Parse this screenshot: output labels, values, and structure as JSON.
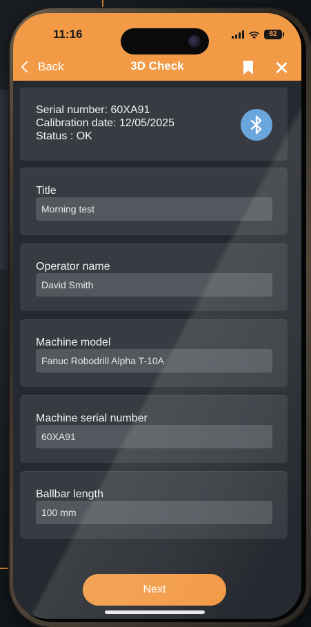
{
  "status_bar": {
    "time": "11:16",
    "battery": "82"
  },
  "nav": {
    "back_label": "Back",
    "title": "3D Check"
  },
  "device": {
    "serial_line": "Serial number: 60XA91",
    "calibration_line": "Calibration date: 12/05/2025",
    "status_line": "Status : OK"
  },
  "fields": [
    {
      "label": "Title",
      "value": "Morning test"
    },
    {
      "label": "Operator name",
      "value": "David Smith"
    },
    {
      "label": "Machine model",
      "value": "Fanuc Robodrill Alpha T-10A"
    },
    {
      "label": "Machine serial number",
      "value": "60XA91"
    },
    {
      "label": "Ballbar length",
      "value": "100 mm"
    }
  ],
  "actions": {
    "next_label": "Next"
  },
  "colors": {
    "accent": "#f29a45",
    "card": "#383c42",
    "input": "#54585e",
    "bluetooth": "#6aa6dc"
  },
  "icons": {
    "back": "chevron-left-icon",
    "bookmark": "bookmark-icon",
    "close": "close-icon",
    "bluetooth": "bluetooth-icon",
    "signal": "cellular-signal-icon",
    "wifi": "wifi-icon",
    "battery": "battery-icon"
  }
}
